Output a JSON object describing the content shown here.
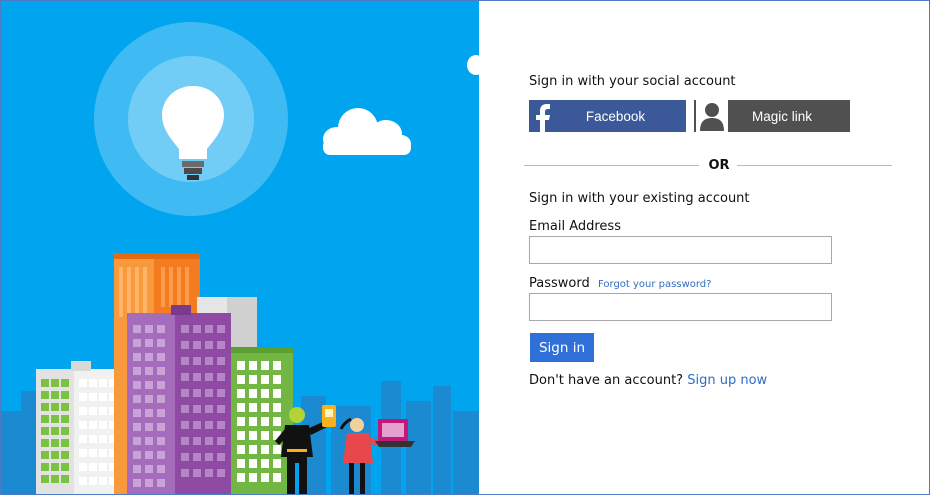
{
  "hero": {
    "colors": {
      "sky": "#00a4ef",
      "bulb_halo_outer": "#3fbaf2",
      "bulb_halo_inner": "#72cdf6",
      "building_orange": "#f47c20",
      "building_purple": "#8f4aa3",
      "building_green": "#72b744"
    },
    "icons": [
      "lightbulb-icon",
      "cloud-icon"
    ]
  },
  "social": {
    "heading": "Sign in with your social account",
    "facebook_label": "Facebook",
    "magic_link_label": "Magic link",
    "facebook_color": "#3b5998",
    "magic_link_color": "#505050"
  },
  "divider": {
    "or_label": "OR"
  },
  "local": {
    "heading": "Sign in with your existing account",
    "email_label": "Email Address",
    "email_value": "",
    "password_label": "Password",
    "password_value": "",
    "forgot_label": "Forgot your password?",
    "signin_label": "Sign in",
    "signin_color": "#2f6fd8",
    "no_account_text": "Don't have an account?",
    "signup_label": "Sign up now"
  }
}
